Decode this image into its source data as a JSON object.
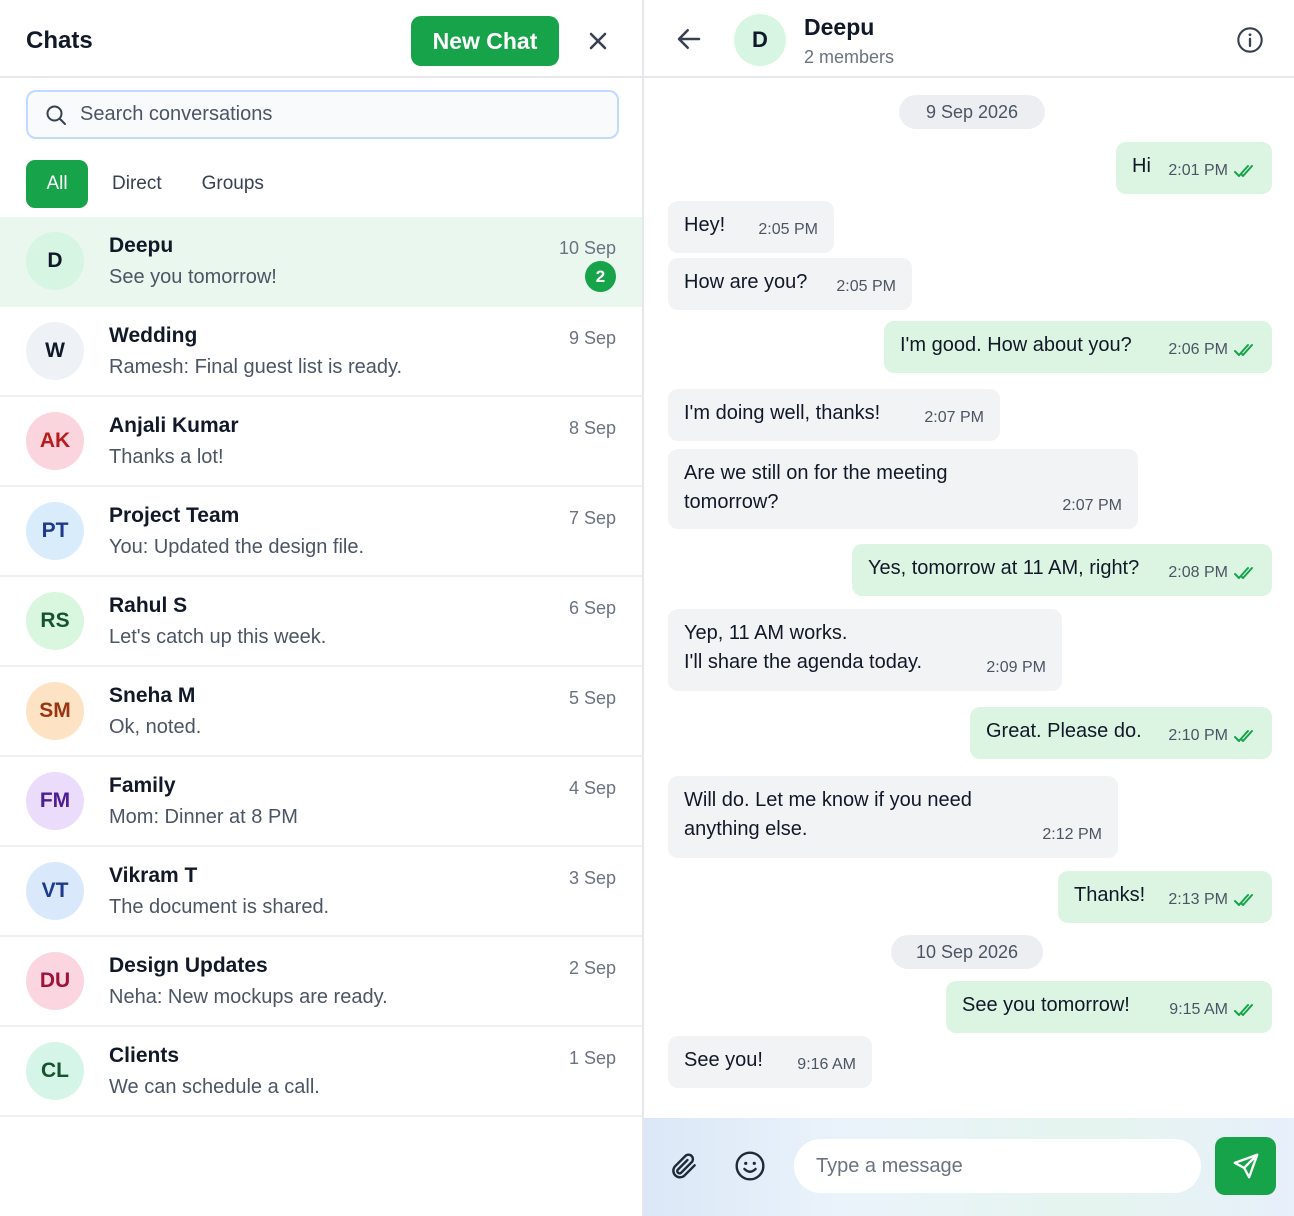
{
  "colors": {
    "accent": "#16a34a",
    "selected_row": "#e9f7ee",
    "outgoing_bubble": "#dcf5e3",
    "incoming_bubble": "#f1f3f5"
  },
  "sidebar": {
    "title": "Chats",
    "new_chat_label": "New Chat",
    "close_icon": "close-icon",
    "search_placeholder": "Search conversations",
    "search_value": "",
    "filters": [
      {
        "label": "All",
        "active": true
      },
      {
        "label": "Direct",
        "active": false
      },
      {
        "label": "Groups",
        "active": false
      }
    ],
    "chats": [
      {
        "initials": "D",
        "name": "Deepu",
        "preview": "See you tomorrow!",
        "date": "10 Sep",
        "unread": "2",
        "selected": true,
        "avatar_bg": "#d7f5e3",
        "avatar_fg": "#111827"
      },
      {
        "initials": "W",
        "name": "Wedding",
        "preview": "Ramesh: Final guest list is ready.",
        "date": "9 Sep",
        "unread": "",
        "selected": false,
        "avatar_bg": "#eef2f7",
        "avatar_fg": "#111827"
      },
      {
        "initials": "AK",
        "name": "Anjali Kumar",
        "preview": "Thanks a lot!",
        "date": "8 Sep",
        "unread": "",
        "selected": false,
        "avatar_bg": "#fbd5dd",
        "avatar_fg": "#b91c1c"
      },
      {
        "initials": "PT",
        "name": "Project Team",
        "preview": "You: Updated the design file.",
        "date": "7 Sep",
        "unread": "",
        "selected": false,
        "avatar_bg": "#d8ecfb",
        "avatar_fg": "#1e3a8a"
      },
      {
        "initials": "RS",
        "name": "Rahul S",
        "preview": "Let's catch up this week.",
        "date": "6 Sep",
        "unread": "",
        "selected": false,
        "avatar_bg": "#d9f6df",
        "avatar_fg": "#14532d"
      },
      {
        "initials": "SM",
        "name": "Sneha M",
        "preview": "Ok, noted.",
        "date": "5 Sep",
        "unread": "",
        "selected": false,
        "avatar_bg": "#fde3c3",
        "avatar_fg": "#9a3412"
      },
      {
        "initials": "FM",
        "name": "Family",
        "preview": "Mom: Dinner at 8 PM",
        "date": "4 Sep",
        "unread": "",
        "selected": false,
        "avatar_bg": "#ebdcfc",
        "avatar_fg": "#4c1d95"
      },
      {
        "initials": "VT",
        "name": "Vikram T",
        "preview": "The document is shared.",
        "date": "3 Sep",
        "unread": "",
        "selected": false,
        "avatar_bg": "#d9e9fb",
        "avatar_fg": "#1e3a8a"
      },
      {
        "initials": "DU",
        "name": "Design Updates",
        "preview": "Neha: New mockups are ready.",
        "date": "2 Sep",
        "unread": "",
        "selected": false,
        "avatar_bg": "#fbd5e0",
        "avatar_fg": "#9f1239"
      },
      {
        "initials": "CL",
        "name": "Clients",
        "preview": "We can schedule a call.",
        "date": "1 Sep",
        "unread": "",
        "selected": false,
        "avatar_bg": "#d5f5e8",
        "avatar_fg": "#14532d"
      }
    ]
  },
  "conversation": {
    "back_icon": "back-arrow-icon",
    "avatar_initials": "D",
    "name": "Deepu",
    "subtitle": "2 members",
    "info_icon": "info-icon",
    "items": [
      {
        "kind": "date",
        "text": "9 Sep 2026"
      },
      {
        "kind": "msg",
        "dir": "out",
        "text": "Hi",
        "time": "2:01 PM",
        "read": true
      },
      {
        "kind": "msg",
        "dir": "in",
        "text": "Hey!",
        "time": "2:05 PM"
      },
      {
        "kind": "msg",
        "dir": "in",
        "text": "How are you?",
        "time": "2:05 PM"
      },
      {
        "kind": "msg",
        "dir": "out",
        "text": "I'm good. How about you?",
        "time": "2:06 PM",
        "read": true
      },
      {
        "kind": "msg",
        "dir": "in",
        "text": "I'm doing well, thanks!",
        "time": "2:07 PM"
      },
      {
        "kind": "msg",
        "dir": "in",
        "text": "Are we still on for the meeting\ntomorrow?",
        "time": "2:07 PM"
      },
      {
        "kind": "msg",
        "dir": "out",
        "text": "Yes, tomorrow at 11 AM, right?",
        "time": "2:08 PM",
        "read": true
      },
      {
        "kind": "msg",
        "dir": "in",
        "text": "Yep, 11 AM works.\nI'll share the agenda today.",
        "time": "2:09 PM"
      },
      {
        "kind": "msg",
        "dir": "out",
        "text": "Great. Please do.",
        "time": "2:10 PM",
        "read": true
      },
      {
        "kind": "msg",
        "dir": "in",
        "text": "Will do. Let me know if you need\nanything else.",
        "time": "2:12 PM"
      },
      {
        "kind": "msg",
        "dir": "out",
        "text": "Thanks!",
        "time": "2:13 PM",
        "read": true
      },
      {
        "kind": "date",
        "text": "10 Sep 2026"
      },
      {
        "kind": "msg",
        "dir": "out",
        "text": "See you tomorrow!",
        "time": "9:15 AM",
        "read": true
      },
      {
        "kind": "msg",
        "dir": "in",
        "text": "See you!",
        "time": "9:16 AM"
      }
    ]
  },
  "composer": {
    "placeholder": "Type a message",
    "value": "",
    "attach_icon": "paperclip-icon",
    "emoji_icon": "smiley-icon",
    "send_icon": "send-icon"
  }
}
